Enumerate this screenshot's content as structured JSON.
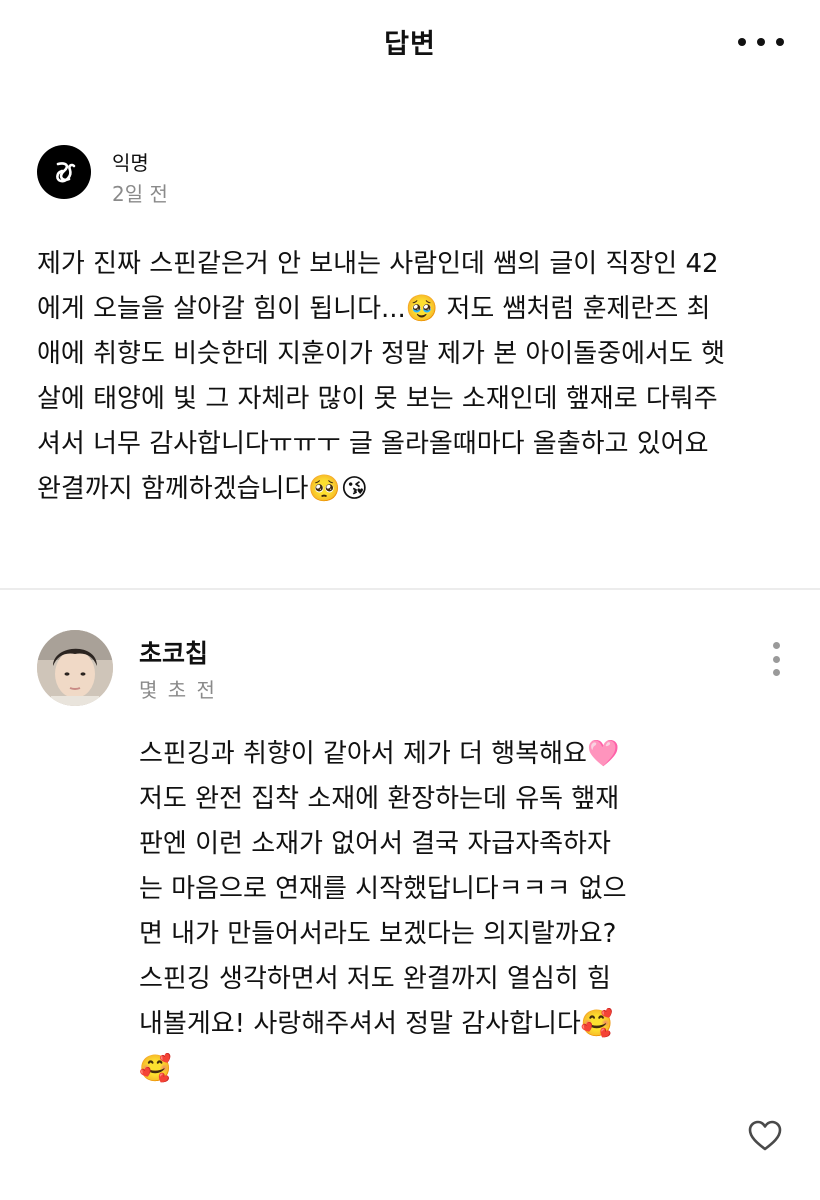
{
  "header": {
    "title": "답변",
    "more_icon": "more-horizontal-icon"
  },
  "question": {
    "author": "익명",
    "time": "2일 전",
    "avatar_icon": "anonymous-logo-icon",
    "text": "제가 진짜 스핀같은거 안 보내는 사람인데 쌤의 글이 직장인 42\n에게 오늘을 살아갈 힘이 됩니다...🥹 저도 쌤처럼 훈제란즈 최\n애에 취향도 비슷한데 지훈이가 정말 제가 본 아이돌중에서도 햇\n살에 태양에 빛 그 자체라 많이 못 보는 소재인데 햎재로 다뤄주\n셔서 너무 감사합니다ㅠㅠㅜ 글 올라올때마다 올출하고 있어요\n완결까지 함께하겠습니다🥺😘"
  },
  "answer": {
    "author": "초코칩",
    "time": "몇 초 전",
    "avatar_icon": "profile-photo",
    "menu_icon": "more-vertical-icon",
    "text": "스핀깅과 취향이 같아서 제가 더 행복해요🩷\n저도 완전 집착 소재에 환장하는데 유독 햎재\n판엔 이런 소재가 없어서 결국 자급자족하자\n는 마음으로 연재를 시작했답니다ㅋㅋㅋ 없으\n면 내가 만들어서라도 보겠다는 의지랄까요?\n스핀깅 생각하면서 저도 완결까지 열심히 힘\n내볼게요! 사랑해주셔서 정말 감사합니다🥰\n🥰"
  },
  "footer": {
    "like_icon": "heart-outline-icon"
  },
  "colors": {
    "text": "#111111",
    "muted": "#8a8a8a",
    "divider": "#ececec",
    "background": "#ffffff"
  }
}
